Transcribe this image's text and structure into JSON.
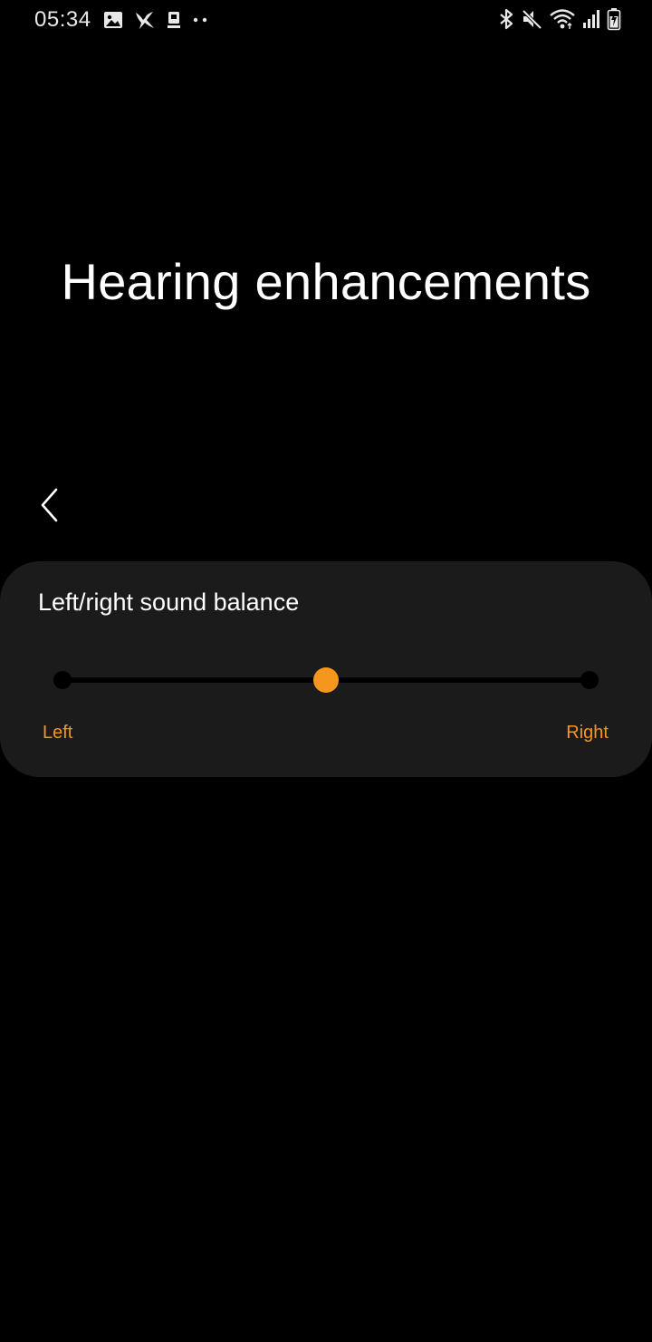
{
  "status_bar": {
    "time": "05:34",
    "left_icons": [
      "gallery-icon",
      "hummingbird-icon",
      "sim-card-icon",
      "more-notifications-icon"
    ],
    "right_icons": [
      "bluetooth-icon",
      "mute-icon",
      "wifi-icon",
      "signal-icon",
      "battery-icon"
    ]
  },
  "page": {
    "title": "Hearing enhancements",
    "back_icon": "back-chevron-icon"
  },
  "balance": {
    "title": "Left/right sound balance",
    "left_label": "Left",
    "right_label": "Right",
    "value": 0.5
  },
  "colors": {
    "background": "#000000",
    "card": "#1b1b1b",
    "accent": "#f5961e"
  }
}
